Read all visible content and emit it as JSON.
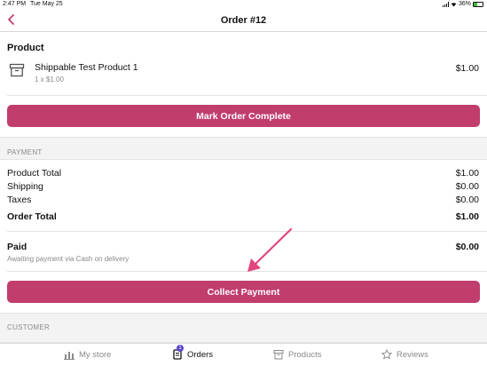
{
  "status_bar": {
    "time": "2:47 PM",
    "date": "Tue May 25",
    "battery": "36%",
    "battery_level": 0.36
  },
  "nav": {
    "title": "Order #12"
  },
  "product_section": {
    "title": "Product",
    "items": [
      {
        "name": "Shippable Test Product 1",
        "qty_line": "1 x $1.00",
        "price": "$1.00"
      }
    ]
  },
  "mark_complete_button": "Mark Order Complete",
  "payment_section": {
    "label": "PAYMENT",
    "rows": [
      {
        "label": "Product Total",
        "value": "$1.00"
      },
      {
        "label": "Shipping",
        "value": "$0.00"
      },
      {
        "label": "Taxes",
        "value": "$0.00"
      }
    ],
    "order_total": {
      "label": "Order Total",
      "value": "$1.00"
    },
    "paid": {
      "label": "Paid",
      "value": "$0.00",
      "sub": "Awaiting payment via Cash on delivery"
    }
  },
  "collect_payment_button": "Collect Payment",
  "customer_section": {
    "label": "CUSTOMER"
  },
  "tab_bar": {
    "tabs": [
      {
        "label": "My store",
        "icon": "bar-chart-icon"
      },
      {
        "label": "Orders",
        "icon": "orders-icon",
        "badge": "1"
      },
      {
        "label": "Products",
        "icon": "box-icon"
      },
      {
        "label": "Reviews",
        "icon": "star-icon"
      }
    ]
  },
  "colors": {
    "accent": "#c13d6d",
    "badge": "#5a46c8",
    "arrow": "#e0457e"
  }
}
